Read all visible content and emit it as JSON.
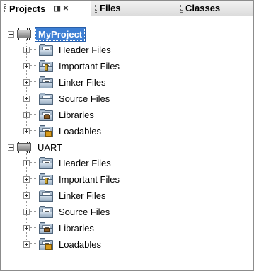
{
  "tabs": [
    {
      "label": "Projects",
      "active": true
    },
    {
      "label": "Files",
      "active": false
    },
    {
      "label": "Classes",
      "active": false
    }
  ],
  "tab_controls": {
    "pin_glyph": "◨",
    "close_glyph": "⌘"
  },
  "projects": [
    {
      "name": "MyProject",
      "selected": true,
      "expanded": true,
      "children": [
        {
          "label": "Header Files",
          "icon": "header-files-folder-icon"
        },
        {
          "label": "Important Files",
          "icon": "important-files-folder-icon"
        },
        {
          "label": "Linker Files",
          "icon": "linker-files-folder-icon"
        },
        {
          "label": "Source Files",
          "icon": "source-files-folder-icon"
        },
        {
          "label": "Libraries",
          "icon": "libraries-folder-icon"
        },
        {
          "label": "Loadables",
          "icon": "loadables-folder-icon"
        }
      ]
    },
    {
      "name": "UART",
      "selected": false,
      "expanded": true,
      "children": [
        {
          "label": "Header Files",
          "icon": "header-files-folder-icon"
        },
        {
          "label": "Important Files",
          "icon": "important-files-folder-icon"
        },
        {
          "label": "Linker Files",
          "icon": "linker-files-folder-icon"
        },
        {
          "label": "Source Files",
          "icon": "source-files-folder-icon"
        },
        {
          "label": "Libraries",
          "icon": "libraries-folder-icon"
        },
        {
          "label": "Loadables",
          "icon": "loadables-folder-icon"
        }
      ]
    }
  ],
  "colors": {
    "selection": "#3d7fd4",
    "tab_bar": "#dcdcdc"
  }
}
